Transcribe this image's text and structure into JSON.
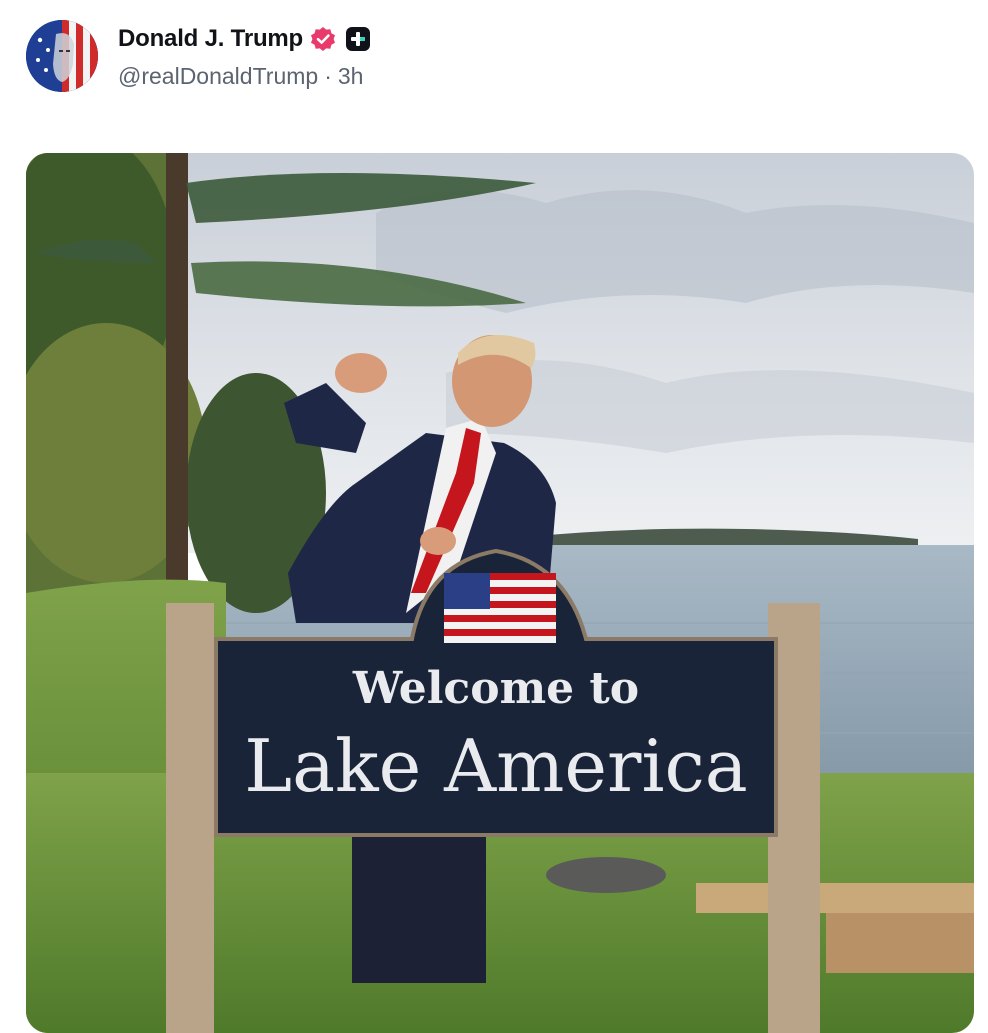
{
  "post": {
    "author": {
      "display_name": "Donald J. Trump",
      "handle": "@realDonaldTrump",
      "verified_icon": "verified-badge-icon",
      "platform_icon": "truth-social-plus-icon"
    },
    "separator": "·",
    "time_ago": "3h",
    "media": {
      "sign_line1": "Welcome to",
      "sign_line2": "Lake America"
    }
  },
  "colors": {
    "text_primary": "#111318",
    "text_secondary": "#5b6470",
    "verified_pink": "#e83a6b",
    "sign_navy": "#1a2438"
  }
}
